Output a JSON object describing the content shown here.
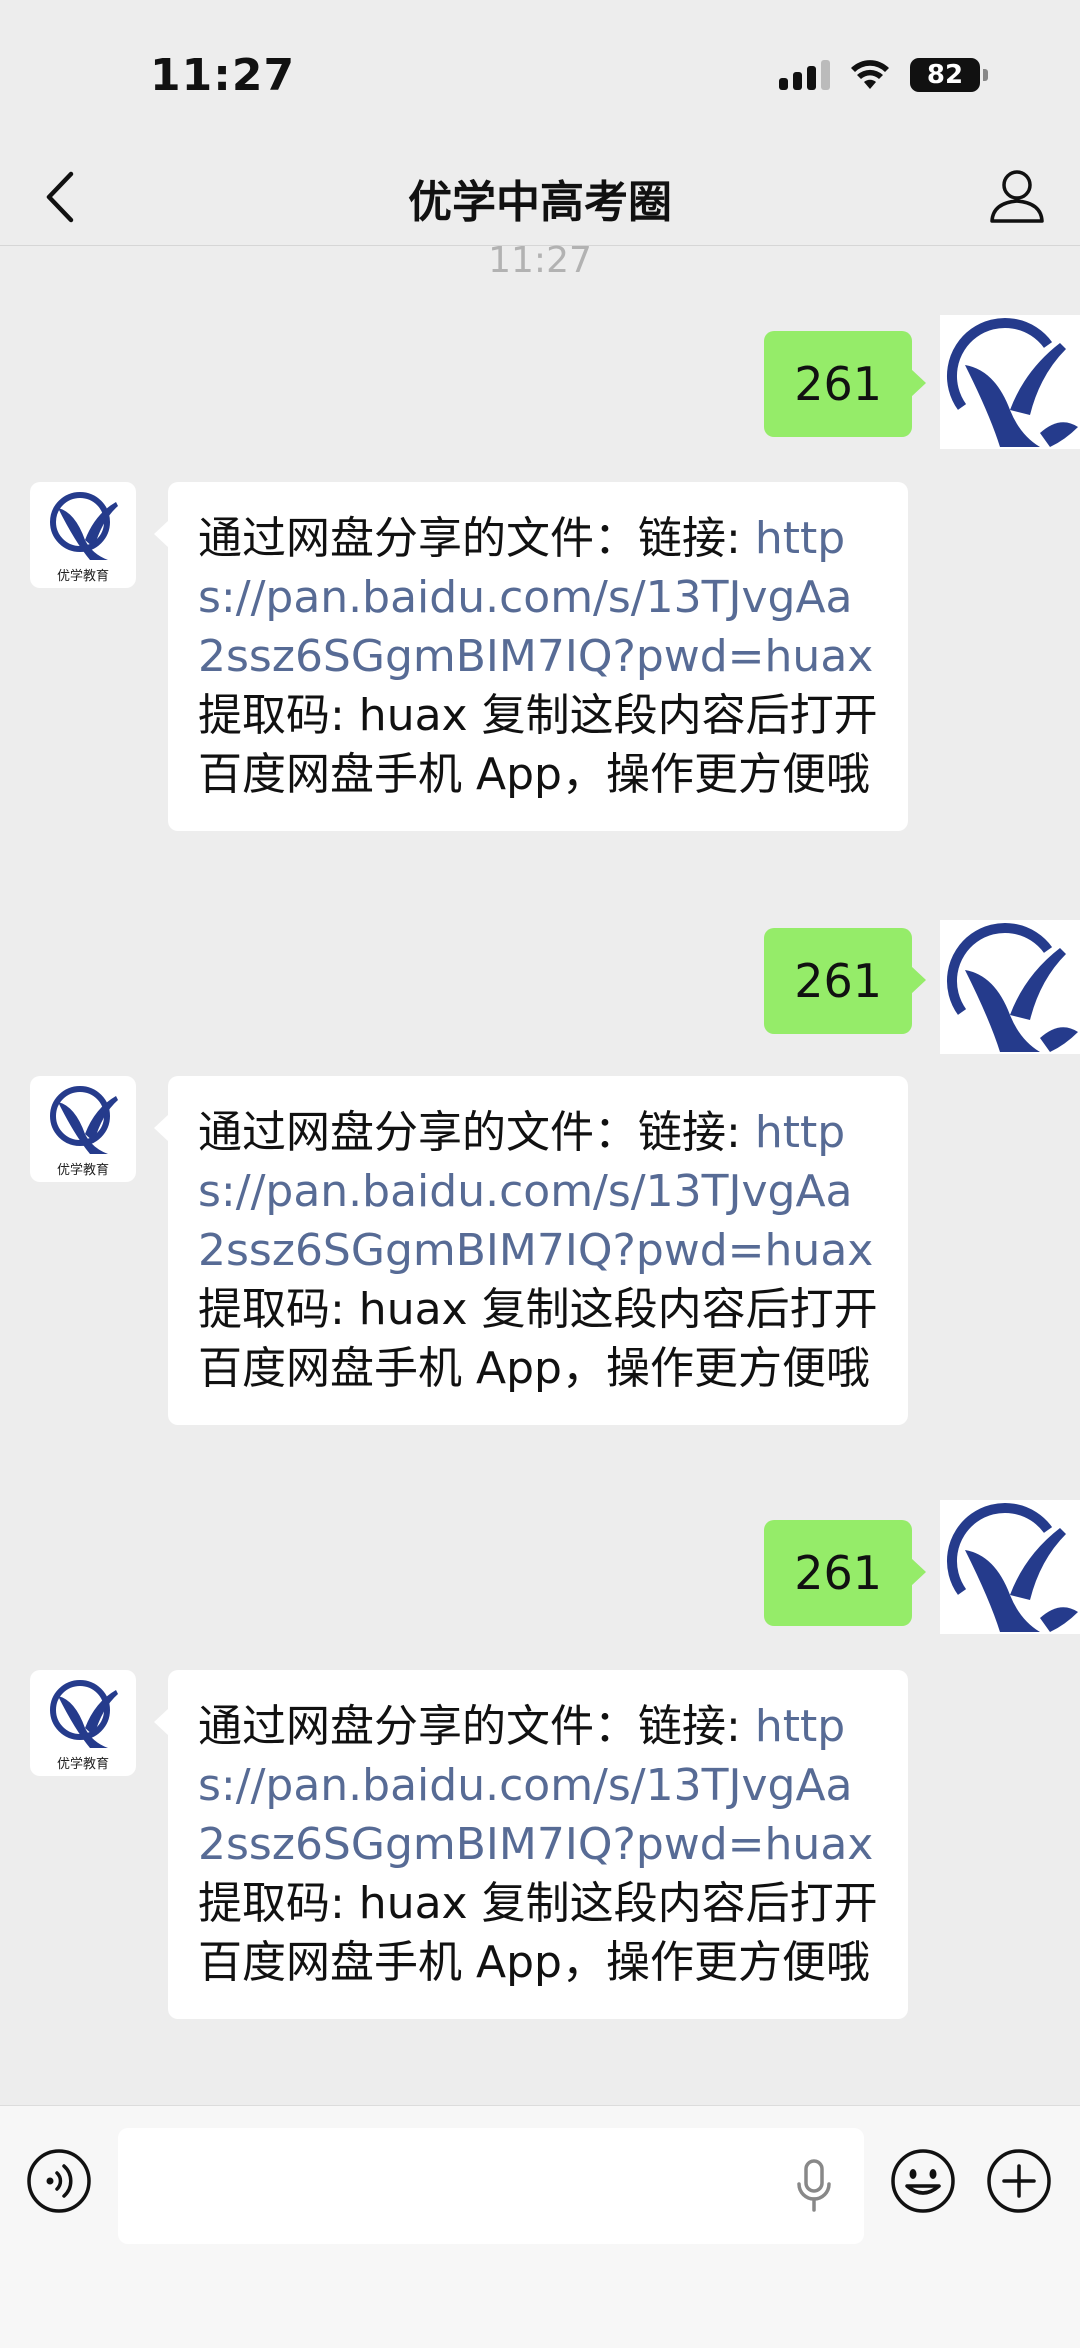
{
  "status_bar": {
    "time": "11:27",
    "battery": "82"
  },
  "header": {
    "title": "优学中高考圈"
  },
  "chat": {
    "timestamp": "11:27",
    "messages": [
      {
        "from": "me",
        "text": "261"
      },
      {
        "from": "contact",
        "prefix": "通过网盘分享的文件：链接: ",
        "link": "https://pan.baidu.com/s/13TJvgAa2ssz6SGgmBIM7IQ?pwd=huax",
        "suffix": " 提取码: huax 复制这段内容后打开百度网盘手机 App，操作更方便哦"
      },
      {
        "from": "me",
        "text": "261"
      },
      {
        "from": "contact",
        "prefix": "通过网盘分享的文件：链接: ",
        "link": "https://pan.baidu.com/s/13TJvgAa2ssz6SGgmBIM7IQ?pwd=huax",
        "suffix": " 提取码: huax 复制这段内容后打开百度网盘手机 App，操作更方便哦"
      },
      {
        "from": "me",
        "text": "261"
      },
      {
        "from": "contact",
        "prefix": "通过网盘分享的文件：链接: ",
        "link": "https://pan.baidu.com/s/13TJvgAa2ssz6SGgmBIM7IQ?pwd=huax",
        "suffix": " 提取码: huax 复制这段内容后打开百度网盘手机 App，操作更方便哦"
      }
    ],
    "contact_avatar_caption": "优学教育"
  },
  "input_bar": {
    "value": ""
  },
  "colors": {
    "sent_bubble": "#95ec69",
    "link": "#576b95",
    "logo_blue": "#253b8c"
  },
  "icons": {
    "back": "chevron-left-icon",
    "profile": "person-icon",
    "voice": "voice-icon",
    "mic": "microphone-icon",
    "emoji": "emoji-icon",
    "more": "plus-icon"
  }
}
